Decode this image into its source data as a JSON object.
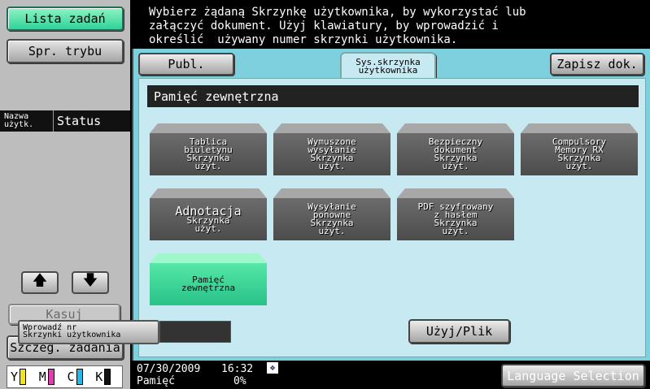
{
  "left_panel": {
    "jobs_button": "Lista zadań",
    "mode_button": "Spr. trybu",
    "status_col_user": "Nazwa użytk.",
    "status_col_status": "Status",
    "up_arrow": "🡅",
    "down_arrow": "🡇",
    "cancel_button": "Kasuj",
    "details_button": "Szczeg. zadania",
    "toner": [
      {
        "label": "Y",
        "color": "#f4e21a"
      },
      {
        "label": "M",
        "color": "#e23bb3"
      },
      {
        "label": "C",
        "color": "#27b7e8"
      },
      {
        "label": "K",
        "color": "#111111"
      }
    ]
  },
  "message": "Wybierz żądaną Skrzynkę użytkownika, by wykorzystać lub\nzałączyć dokument. Użyj klawiatury, by wprowadzić i\nokreślić  używany numer skrzynki użytkownika.",
  "tabs": {
    "public": "Publ.",
    "system_user_box": "Sys.skrzynka\nużytkownika",
    "save_document": "Zapisz dok."
  },
  "section_title": "Pamięć zewnętrzna",
  "boxes": [
    {
      "lines": [
        "Tablica",
        "biuletynu",
        "Skrzynka",
        "użyt."
      ]
    },
    {
      "lines": [
        "Wymuszone",
        "wysyłanie",
        "Skrzynka",
        "użyt."
      ]
    },
    {
      "lines": [
        "Bezpieczny",
        "dokument",
        "Skrzynka",
        "użyt."
      ]
    },
    {
      "lines": [
        "Compulsory",
        "Memory RX",
        "Skrzynka",
        "użyt."
      ]
    },
    {
      "lines": [
        "Adnotacja",
        "Skrzynka",
        "użyt."
      ]
    },
    {
      "lines": [
        "Wysyłanie",
        "ponowne",
        "Skrzynka",
        "użyt."
      ]
    },
    {
      "lines": [
        "PDF szyfrowany",
        "z hasłem",
        "Skrzynka",
        "użyt."
      ]
    },
    {
      "lines": [
        "Pamięć",
        "zewnętrzna"
      ]
    }
  ],
  "input_button": "Wprowadź nr\nSkrzynki użytkownika",
  "use_button": "Użyj/Plik",
  "footer": {
    "date": "07/30/2009",
    "time": "16:32",
    "memory_label": "Pamięć",
    "memory_value": "0%",
    "language_button": "Language Selection"
  }
}
